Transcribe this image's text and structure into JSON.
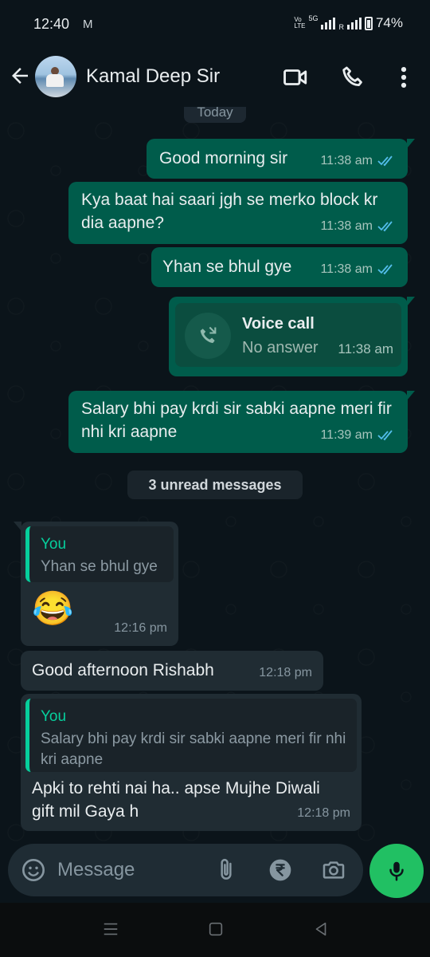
{
  "status": {
    "time": "12:40",
    "mail": "M",
    "volte": "Vo",
    "lte": "LTE",
    "net": "5G",
    "r_mark": "R",
    "battery": "74%"
  },
  "header": {
    "contact": "Kamal Deep Sir"
  },
  "chat": {
    "date_chip": "Today",
    "messages": [
      {
        "text": "Good morning sir",
        "time": "11:38 am"
      },
      {
        "text": "Kya baat hai saari jgh se merko block kr dia aapne?",
        "time": "11:38 am"
      },
      {
        "text": "Yhan se bhul gye",
        "time": "11:38 am"
      },
      {
        "call_title": "Voice call",
        "call_sub": "No answer",
        "time": "11:38 am"
      },
      {
        "text": "Salary bhi pay krdi sir sabki aapne meri fir nhi kri aapne",
        "time": "11:39 am"
      }
    ],
    "unread_label": "3 unread messages",
    "incoming": [
      {
        "quote_name": "You",
        "quote_text": "Yhan se bhul gye",
        "text": "😂",
        "time": "12:16 pm"
      },
      {
        "text": "Good afternoon Rishabh",
        "time": "12:18 pm"
      },
      {
        "quote_name": "You",
        "quote_text": "Salary bhi pay krdi sir sabki aapne meri fir nhi kri aapne",
        "text": "Apki to rehti nai ha.. apse Mujhe Diwali gift mil Gaya h",
        "time": "12:18 pm"
      }
    ]
  },
  "input": {
    "placeholder": "Message"
  },
  "colors": {
    "accent": "#21c063",
    "outgoing": "#005c4b",
    "incoming": "#202c33",
    "read_ticks": "#53bdeb"
  }
}
